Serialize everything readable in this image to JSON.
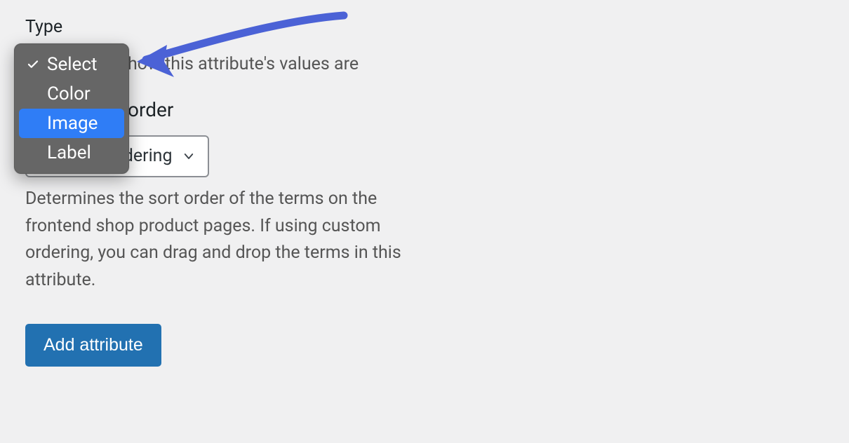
{
  "type_field": {
    "label": "Type",
    "options": [
      "Select",
      "Color",
      "Image",
      "Label"
    ],
    "selected_index": 0,
    "hover_index": 2,
    "help_partial": "how this attribute's values are"
  },
  "sort_field": {
    "label_partial": "order",
    "selected": "Custom ordering",
    "help": "Determines the sort order of the terms on the frontend shop product pages. If using custom ordering, you can drag and drop the terms in this attribute."
  },
  "submit": {
    "label": "Add attribute"
  }
}
